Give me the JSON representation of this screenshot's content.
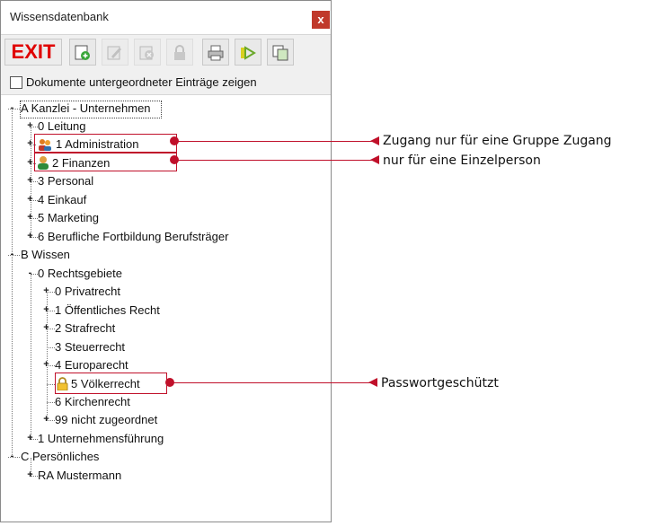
{
  "window": {
    "title": "Wissensdatenbank",
    "close_label": "x"
  },
  "toolbar": {
    "exit_label": "EXIT"
  },
  "option": {
    "label": "Dokumente untergeordneter Einträge zeigen"
  },
  "tree": {
    "a": "A Kanzlei - Unternehmen",
    "a0": "0 Leitung",
    "a1": "1 Administration",
    "a2": "2 Finanzen",
    "a3": "3 Personal",
    "a4": "4 Einkauf",
    "a5": "5 Marketing",
    "a6": "6 Berufliche Fortbildung Berufsträger",
    "b": "B Wissen",
    "b0": "0 Rechtsgebiete",
    "b00": "0 Privatrecht",
    "b01": "1 Öffentliches Recht",
    "b02": "2 Strafrecht",
    "b03": "3 Steuerrecht",
    "b04": "4 Europarecht",
    "b05": "5 Völkerrecht",
    "b06": "6 Kirchenrecht",
    "b099": "99 nicht zugeordnet",
    "b1": "1 Unternehmensführung",
    "c": "C Persönliches",
    "c1": "RA Mustermann"
  },
  "annotations": {
    "group": "Zugang nur für eine Gruppe Zugang",
    "single": "nur für eine Einzelperson",
    "password": "Passwortgeschützt"
  },
  "colors": {
    "accent": "#c0102a",
    "exit": "#e00000"
  }
}
